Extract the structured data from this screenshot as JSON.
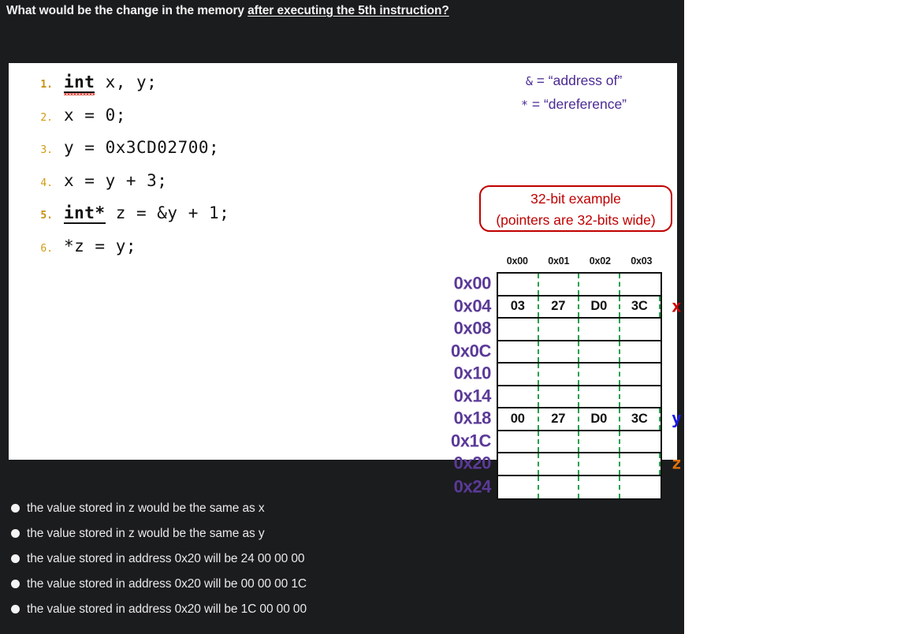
{
  "question": {
    "text_plain": "What would be the change in the memory ",
    "text_emphasis": "after executing the 5th instruction?"
  },
  "code": {
    "lines": [
      {
        "number": "1.",
        "bold": true,
        "text": "int x, y;",
        "keyword": "int",
        "rest": " x, y;"
      },
      {
        "number": "2.",
        "bold": false,
        "text": "x = 0;",
        "keyword": "",
        "rest": "x = 0;"
      },
      {
        "number": "3.",
        "bold": false,
        "text": "y = 0x3CD02700;",
        "keyword": "",
        "rest": "y = 0x3CD02700;"
      },
      {
        "number": "4.",
        "bold": false,
        "text": "x = y + 3;",
        "keyword": "",
        "rest": "x = y + 3;"
      },
      {
        "number": "5.",
        "bold": true,
        "text": "int* z = &y + 1;",
        "keyword": "int*",
        "rest": " z = &y + 1;"
      },
      {
        "number": "6.",
        "bold": false,
        "text": "*z = y;",
        "keyword": "",
        "rest": "*z = y;"
      }
    ]
  },
  "legend": {
    "line1_symbol": "&",
    "line1_text": " = “address of”",
    "line2_symbol": "*",
    "line2_text": " = “dereference”",
    "color": "#4b2a93"
  },
  "callout": {
    "line1": "32-bit example",
    "line2": "(pointers are 32-bits wide)",
    "color": "#c00000"
  },
  "memory": {
    "column_headers": [
      "0x00",
      "0x01",
      "0x02",
      "0x03"
    ],
    "rows": [
      {
        "address": "0x00",
        "cells": [
          "",
          "",
          "",
          ""
        ],
        "marker": "",
        "marker_color": ""
      },
      {
        "address": "0x04",
        "cells": [
          "03",
          "27",
          "D0",
          "3C"
        ],
        "marker": "x",
        "marker_color": "#cc0000"
      },
      {
        "address": "0x08",
        "cells": [
          "",
          "",
          "",
          ""
        ],
        "marker": "",
        "marker_color": ""
      },
      {
        "address": "0x0C",
        "cells": [
          "",
          "",
          "",
          ""
        ],
        "marker": "",
        "marker_color": ""
      },
      {
        "address": "0x10",
        "cells": [
          "",
          "",
          "",
          ""
        ],
        "marker": "",
        "marker_color": ""
      },
      {
        "address": "0x14",
        "cells": [
          "",
          "",
          "",
          ""
        ],
        "marker": "",
        "marker_color": ""
      },
      {
        "address": "0x18",
        "cells": [
          "00",
          "27",
          "D0",
          "3C"
        ],
        "marker": "y",
        "marker_color": "#1a1ae6"
      },
      {
        "address": "0x1C",
        "cells": [
          "",
          "",
          "",
          ""
        ],
        "marker": "",
        "marker_color": ""
      },
      {
        "address": "0x20",
        "cells": [
          "",
          "",
          "",
          ""
        ],
        "marker": "z",
        "marker_color": "#e2720c"
      },
      {
        "address": "0x24",
        "cells": [
          "",
          "",
          "",
          ""
        ],
        "marker": "",
        "marker_color": ""
      }
    ],
    "label_color": "#5b3a98",
    "divider_color": "#22a24b"
  },
  "answers": {
    "options": [
      {
        "label": "the value stored in z would be the same as x",
        "selected": false
      },
      {
        "label": "the value stored in z would be the same as y",
        "selected": false
      },
      {
        "label": "the value stored in address 0x20 will be 24 00 00 00",
        "selected": false
      },
      {
        "label": "the value stored in address 0x20 will be 00 00 00 1C",
        "selected": false
      },
      {
        "label": "the value stored in address 0x20 will be 1C 00 00 00",
        "selected": false
      }
    ]
  }
}
